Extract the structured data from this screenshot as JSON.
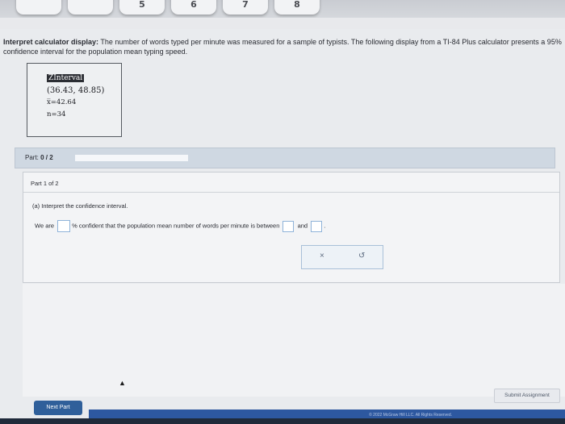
{
  "keyboard": {
    "keys": [
      "",
      "",
      "5",
      "6",
      "7",
      "8"
    ]
  },
  "problem": {
    "heading": "Interpret calculator display:",
    "body": " The number of words typed per minute was measured for a sample of typists. The following display from a TI-84 Plus calculator presents a 95% confidence interval for the population mean typing speed."
  },
  "calculator": {
    "title": "ZInterval",
    "interval": "(36.43, 48.85)",
    "xbar": "x̅=42.64",
    "n": "n=34"
  },
  "part": {
    "label_prefix": "Part: ",
    "progress_text": "0 / 2",
    "progress_fraction": 0.0
  },
  "card": {
    "header": "Part 1 of 2",
    "question": "(a) Interpret the confidence interval.",
    "sentence_1": "We are",
    "sentence_2": "% confident that the population mean number of words per minute is between",
    "sentence_3": "and",
    "sentence_end": ".",
    "clear_icon": "×",
    "undo_icon": "↺"
  },
  "buttons": {
    "next": "Next Part",
    "submit": "Submit Assignment"
  },
  "footer": {
    "text": "© 2022 McGraw Hill LLC. All Rights Reserved."
  },
  "colors": {
    "accent": "#2f5f9a",
    "footer": "#2d58a0",
    "blank_border": "#8fb3d9"
  }
}
